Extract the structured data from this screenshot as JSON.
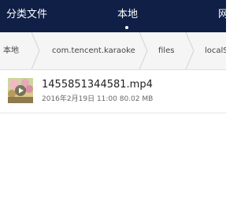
{
  "tabs": [
    {
      "label": "分类文件"
    },
    {
      "label": "本地"
    },
    {
      "label": "网"
    }
  ],
  "active_tab": "本地",
  "breadcrumb": [
    {
      "label": "本地"
    },
    {
      "label": "com.tencent.karaoke"
    },
    {
      "label": "files"
    },
    {
      "label": "localS"
    }
  ],
  "files": [
    {
      "name": "1455851344581.mp4",
      "meta": "2016年2月19日 11:00 80.02 MB",
      "icon": "video-thumbnail-icon"
    }
  ],
  "colors": {
    "top_bar": "#0f1f46",
    "breadcrumb_bg": "#f5f5f5",
    "text_primary": "#1f1f1f",
    "text_secondary": "#666666"
  }
}
